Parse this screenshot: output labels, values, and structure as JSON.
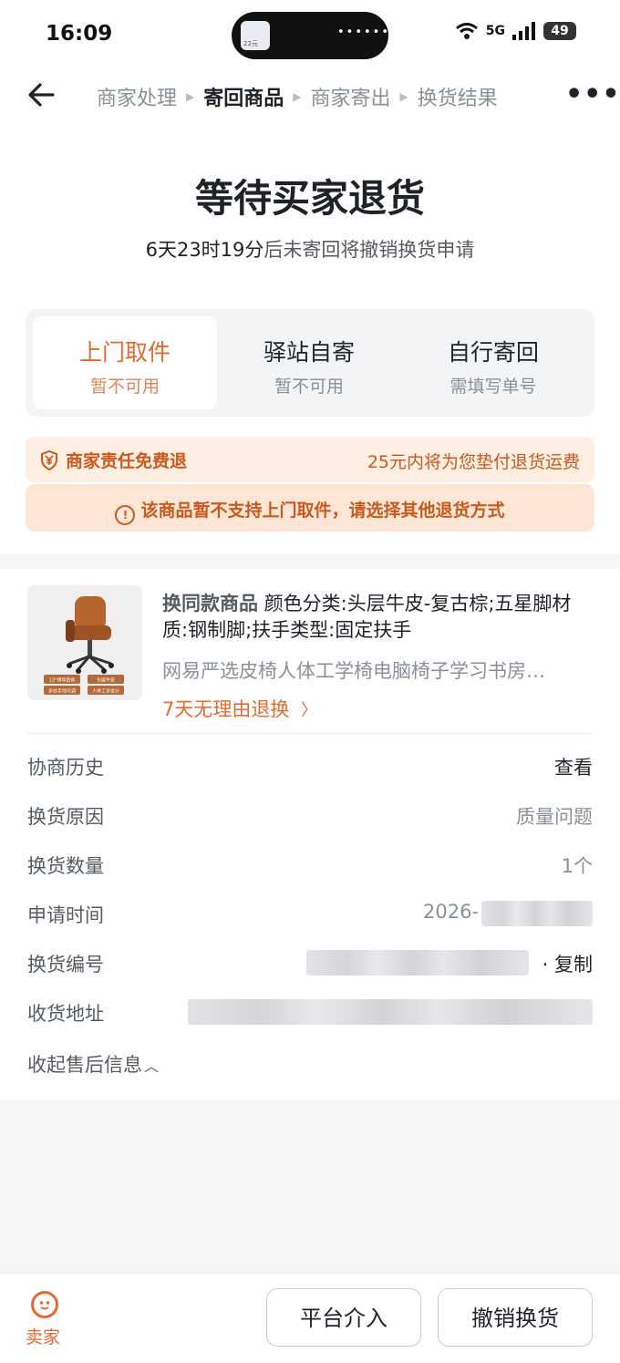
{
  "status_bar": {
    "time": "16:09",
    "battery": "49",
    "network": "5G",
    "island_thumb_text": "22元"
  },
  "nav": {
    "steps": [
      {
        "label": "商家处理",
        "active": false
      },
      {
        "label": "寄回商品",
        "active": true
      },
      {
        "label": "商家寄出",
        "active": false
      },
      {
        "label": "换货结果",
        "active": false
      }
    ]
  },
  "header": {
    "title": "等待买家退货",
    "countdown": "6天23时19分",
    "countdown_suffix": "后未寄回将撤销换货申请"
  },
  "return_methods": [
    {
      "name": "上门取件",
      "status": "暂不可用",
      "selected": true
    },
    {
      "name": "驿站自寄",
      "status": "暂不可用",
      "selected": false
    },
    {
      "name": "自行寄回",
      "status": "需填写单号",
      "selected": false
    }
  ],
  "notices": {
    "policy_label": "商家责任免费退",
    "policy_detail": "25元内将为您垫付退货运费",
    "warning": "该商品暂不支持上门取件，请选择其他退货方式"
  },
  "product": {
    "tag": "换同款商品",
    "spec": "颜色分类:头层牛皮-复古棕;五星脚材质:钢制脚;扶手类型:固定扶手",
    "name": "网易严选皮椅人体工学椅电脑椅子学习书房…",
    "badge": "7天无理由退换",
    "thumb_labels": [
      "13°倾仰后仰",
      "头层牛皮",
      "多处手动可调",
      "人体工学设计"
    ]
  },
  "details": {
    "negotiation_label": "协商历史",
    "negotiation_value": "查看",
    "reason_label": "换货原因",
    "reason_value": "质量问题",
    "quantity_label": "换货数量",
    "quantity_value": "1个",
    "time_label": "申请时间",
    "time_value": "2026-",
    "number_label": "换货编号",
    "number_copy": "· 复制",
    "address_label": "收货地址",
    "collapse_label": "收起售后信息"
  },
  "bottom": {
    "seller_label": "卖家",
    "platform_button": "平台介入",
    "cancel_button": "撤销换货"
  },
  "colors": {
    "accent": "#e8692e",
    "notice_bg": "#fdeee2",
    "notice_text": "#c85a1e"
  }
}
